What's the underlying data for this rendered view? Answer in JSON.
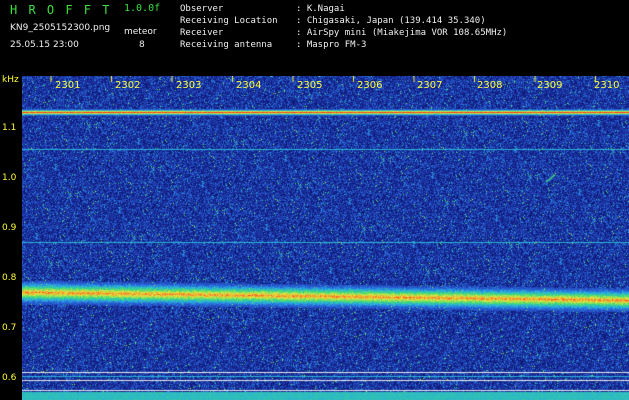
{
  "header": {
    "app_title": "H R O F F T",
    "version": "1.0.0f",
    "filename": "KN9_2505152300.png",
    "mode_label": "meteor",
    "datetime": "25.05.15 23:00",
    "count": "8"
  },
  "info": [
    {
      "label": "Observer",
      "value": ": K.Nagai"
    },
    {
      "label": "Receiving Location",
      "value": ": Chigasaki, Japan (139.414 35.340)"
    },
    {
      "label": "Receiver",
      "value": ": AirSpy mini (Miakejima VOR 108.65MHz)"
    },
    {
      "label": "Receiving antenna",
      "value": ": Maspro FM-3"
    }
  ],
  "axis": {
    "unit": "kHz",
    "y_ticks": [
      "1.1",
      "1.0",
      "0.9",
      "0.8",
      "0.7",
      "0.6"
    ],
    "x_ticks": [
      "2301",
      "2302",
      "2303",
      "2304",
      "2305",
      "2306",
      "2307",
      "2308",
      "2309",
      "2310"
    ]
  },
  "colors": {
    "background": "#1c2f9a",
    "noise_dark": "#0a1a7a",
    "label_green": "#3ce03c",
    "axis_yellow": "#ffff3a",
    "signal_red": "#ff3a1a"
  }
}
